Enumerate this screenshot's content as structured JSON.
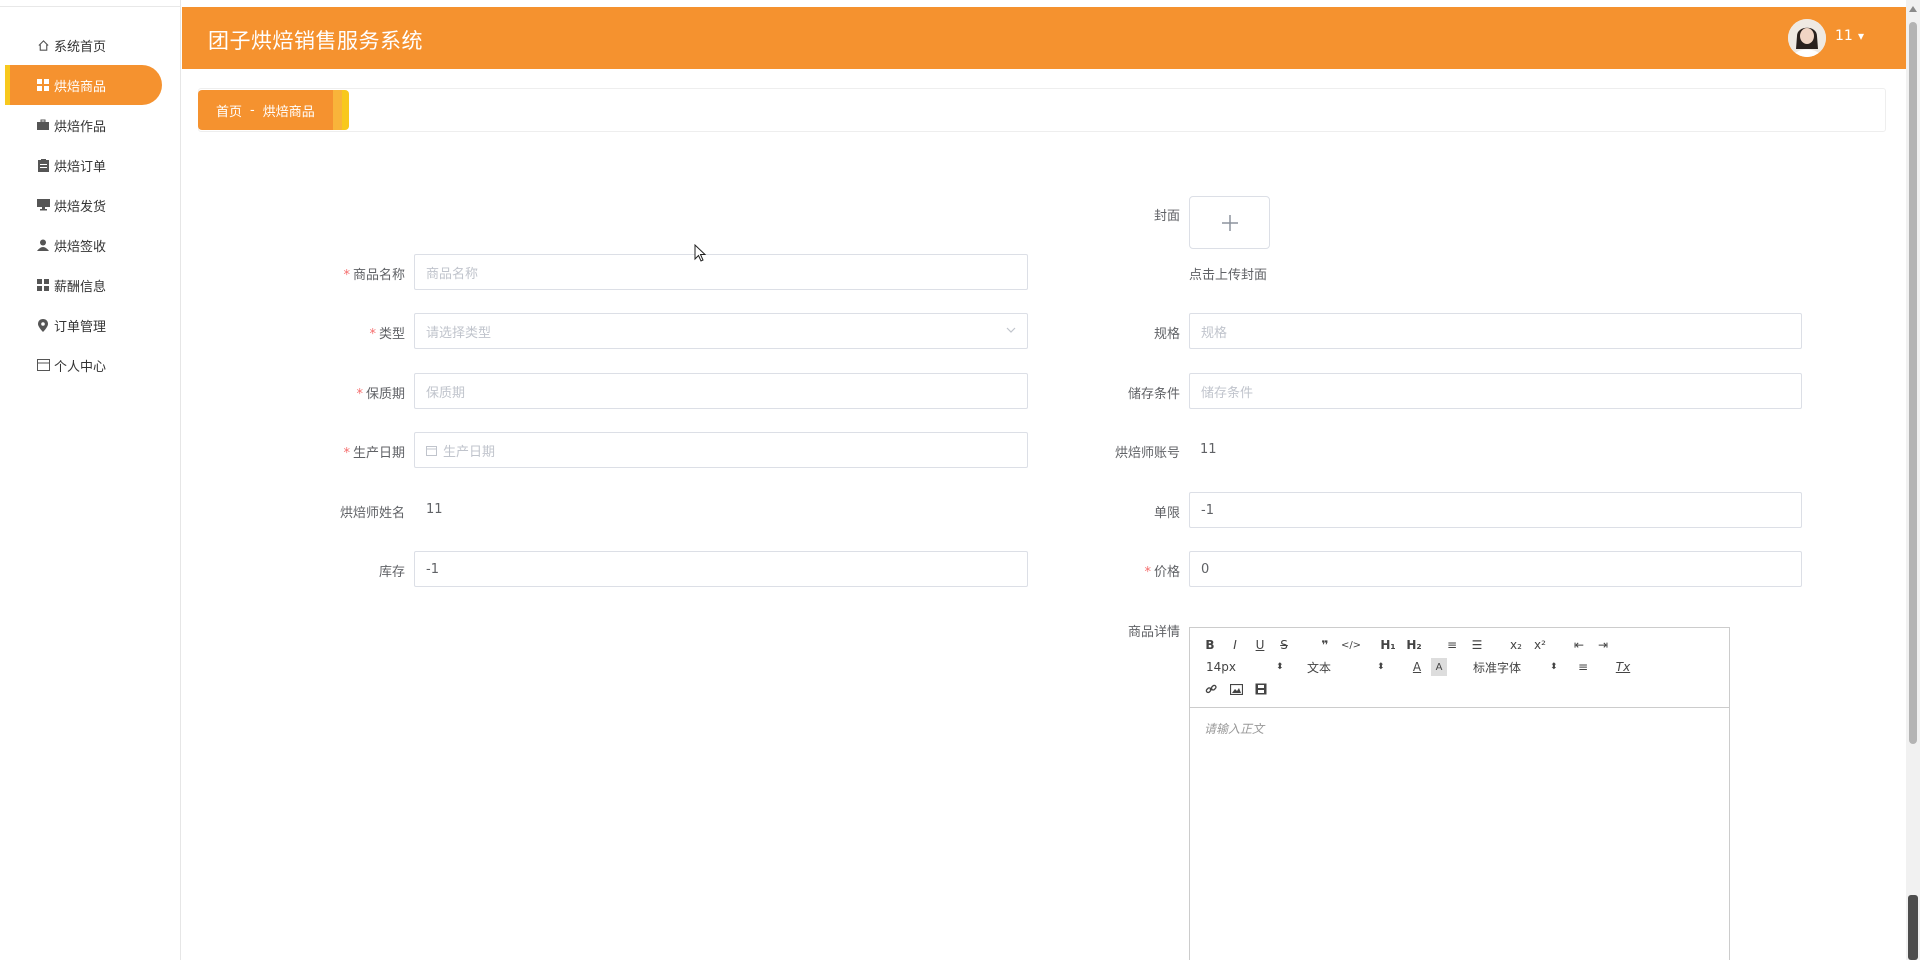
{
  "app": {
    "title": "团子烘焙销售服务系统",
    "username": "11"
  },
  "sidebar": {
    "items": [
      {
        "label": "系统首页",
        "icon": "home-icon",
        "active": false
      },
      {
        "label": "烘焙商品",
        "icon": "grid-icon",
        "active": true
      },
      {
        "label": "烘焙作品",
        "icon": "briefcase-icon",
        "active": false
      },
      {
        "label": "烘焙订单",
        "icon": "clipboard-icon",
        "active": false
      },
      {
        "label": "烘焙发货",
        "icon": "monitor-icon",
        "active": false
      },
      {
        "label": "烘焙签收",
        "icon": "user-icon",
        "active": false
      },
      {
        "label": "薪酬信息",
        "icon": "grid-icon",
        "active": false
      },
      {
        "label": "订单管理",
        "icon": "pin-icon",
        "active": false
      },
      {
        "label": "个人中心",
        "icon": "calendar-icon",
        "active": false
      }
    ]
  },
  "breadcrumb": {
    "home": "首页",
    "separator": "-",
    "current": "烘焙商品"
  },
  "form": {
    "cover": {
      "label": "封面",
      "hint": "点击上传封面"
    },
    "name": {
      "label": "商品名称",
      "placeholder": "商品名称"
    },
    "type": {
      "label": "类型",
      "placeholder": "请选择类型"
    },
    "spec": {
      "label": "规格",
      "placeholder": "规格"
    },
    "shelf_life": {
      "label": "保质期",
      "placeholder": "保质期"
    },
    "storage": {
      "label": "储存条件",
      "placeholder": "储存条件"
    },
    "production_date": {
      "label": "生产日期",
      "placeholder": "生产日期"
    },
    "baker_account": {
      "label": "烘焙师账号",
      "value": "11"
    },
    "baker_name": {
      "label": "烘焙师姓名",
      "value": "11"
    },
    "limit": {
      "label": "单限",
      "value": "-1"
    },
    "stock": {
      "label": "库存",
      "value": "-1"
    },
    "price": {
      "label": "价格",
      "value": "0"
    },
    "detail": {
      "label": "商品详情",
      "placeholder": "请输入正文"
    }
  },
  "editor": {
    "font_size": "14px",
    "text_style": "文本",
    "font_family": "标准字体",
    "buttons": {
      "bold": "B",
      "italic": "I",
      "underline": "U",
      "strike": "S",
      "quote": "❞",
      "code": "</>",
      "h1": "H₁",
      "h2": "H₂",
      "ol": "≡",
      "ul": "☰",
      "sub": "x₂",
      "sup": "x²",
      "indent_out": "⇤",
      "indent_in": "⇥",
      "color": "A",
      "bg": "A",
      "align": "≡",
      "clean": "Tx",
      "link": "🔗",
      "image": "▣",
      "video": "▦"
    }
  },
  "colors": {
    "accent": "#f5922f",
    "accent_light": "#f8c81d",
    "required": "#f56c6c"
  }
}
